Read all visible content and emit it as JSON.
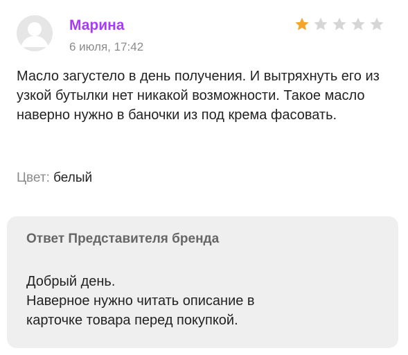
{
  "review": {
    "author": "Марина",
    "date": "6 июля, 17:42",
    "avatar_icon": "user-avatar-icon",
    "rating": {
      "value": 1,
      "max": 5,
      "filled_color": "#f4a62a",
      "empty_color": "#d6d6d6"
    },
    "text": "Масло загустело в день получения. И вытряхнуть его из узкой бутылки нет никакой возможности. Такое масло наверно нужно в баночки из под крема фасовать.",
    "attribute": {
      "label": "Цвет:",
      "value": "белый"
    }
  },
  "brand_reply": {
    "title": "Ответ Представителя бренда",
    "lines": [
      "Добрый день.",
      "Наверное нужно читать описание в",
      "карточке товара перед покупкой."
    ]
  },
  "colors": {
    "author_name": "#a73afd",
    "muted_text": "#8b8b8b",
    "reply_background": "#efefef"
  }
}
